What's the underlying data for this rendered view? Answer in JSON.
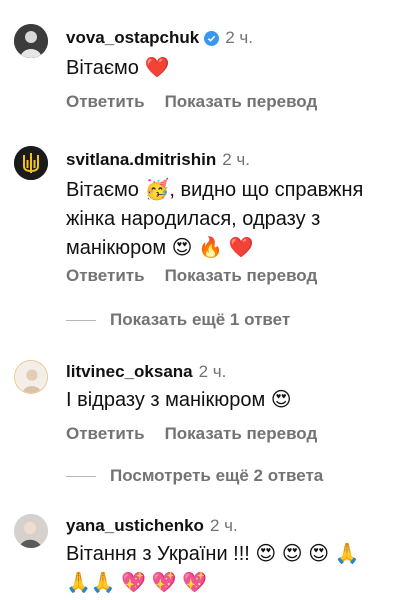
{
  "comments": [
    {
      "username": "vova_ostapchuk",
      "verified": true,
      "time": "2 ч.",
      "text": "Вітаємо ❤️",
      "reply_label": "Ответить",
      "translate_label": "Показать перевод"
    },
    {
      "username": "svitlana.dmitrishin",
      "verified": false,
      "time": "2 ч.",
      "text": "Вітаємо 🥳, видно що справжня жінка народилася, одразу з манікюром 😍 🔥 ❤️",
      "reply_label": "Ответить",
      "translate_label": "Показать перевод",
      "more_replies": "Показать ещё 1 ответ"
    },
    {
      "username": "litvinec_oksana",
      "verified": false,
      "time": "2 ч.",
      "text": "І відразу з манікюром 😍",
      "reply_label": "Ответить",
      "translate_label": "Показать перевод",
      "more_replies": "Посмотреть ещё 2 ответа"
    },
    {
      "username": "yana_ustichenko",
      "verified": false,
      "time": "2 ч.",
      "text": "Вітання з України !!! 😍 😍 😍 🙏🙏🙏 💖 💖 💖"
    }
  ],
  "icons": {
    "verified": "verified-badge-icon",
    "trident": "trident-icon"
  },
  "colors": {
    "verified": "#3897f0",
    "secondary_text": "#737373"
  }
}
